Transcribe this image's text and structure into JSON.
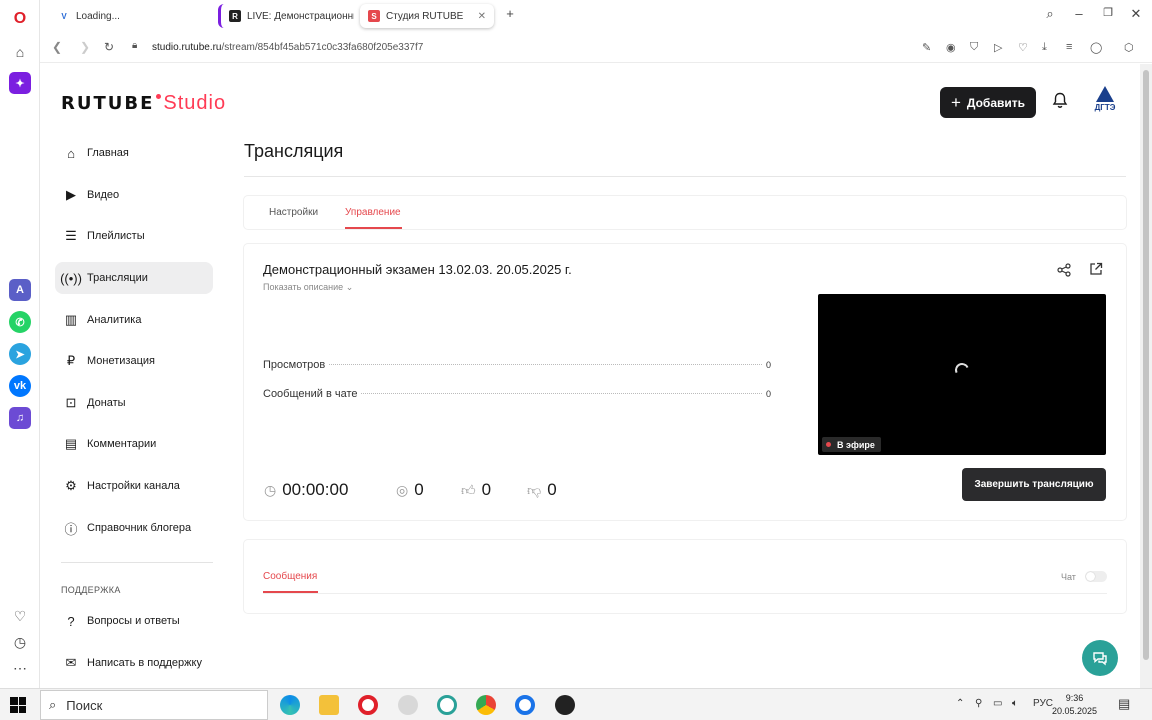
{
  "browser": {
    "tabs": [
      {
        "label": "Loading..."
      },
      {
        "label": "LIVE: Демонстрационный"
      },
      {
        "label": "Студия RUTUBE"
      }
    ],
    "url_host": "studio.rutube.ru",
    "url_path": "/stream/854bf45ab571c0c33fa680f205e337f7"
  },
  "header": {
    "logo_main": "RUTUBE",
    "logo_studio": "Studio",
    "add_label": "Добавить",
    "avatar_text": "ДГТЭ"
  },
  "sidebar": {
    "items": [
      {
        "label": "Главная",
        "icon": "home-icon"
      },
      {
        "label": "Видео",
        "icon": "video-icon"
      },
      {
        "label": "Плейлисты",
        "icon": "playlist-icon"
      },
      {
        "label": "Трансляции",
        "icon": "broadcast-icon"
      },
      {
        "label": "Аналитика",
        "icon": "analytics-icon"
      },
      {
        "label": "Монетизация",
        "icon": "ruble-icon"
      },
      {
        "label": "Донаты",
        "icon": "gift-icon"
      },
      {
        "label": "Комментарии",
        "icon": "comment-icon"
      },
      {
        "label": "Настройки канала",
        "icon": "gear-icon"
      },
      {
        "label": "Справочник блогера",
        "icon": "info-icon"
      }
    ],
    "support_heading": "ПОДДЕРЖКА",
    "support_items": [
      {
        "label": "Вопросы и ответы",
        "icon": "question-icon"
      },
      {
        "label": "Написать в поддержку",
        "icon": "mail-icon"
      }
    ]
  },
  "main": {
    "title": "Трансляция",
    "tabs": [
      {
        "label": "Настройки"
      },
      {
        "label": "Управление"
      }
    ],
    "stream_title": "Демонстрационный экзамен 13.02.03. 20.05.2025 г.",
    "show_description": "Показать описание",
    "stats": [
      {
        "label": "Просмотров",
        "value": "0"
      },
      {
        "label": "Сообщений в чате",
        "value": "0"
      }
    ],
    "live_badge": "В эфире",
    "timer": "00:00:00",
    "viewers": "0",
    "likes": "0",
    "dislikes": "0",
    "end_button": "Завершить трансляцию",
    "messages_tab": "Сообщения",
    "chat_label": "Чат"
  },
  "taskbar": {
    "search_placeholder": "Поиск",
    "lang": "РУС",
    "time": "9:36",
    "date": "20.05.2025"
  },
  "colors": {
    "accent": "#e5484d",
    "dark_button": "#1c1c1e",
    "help_fab": "#2aa198"
  }
}
